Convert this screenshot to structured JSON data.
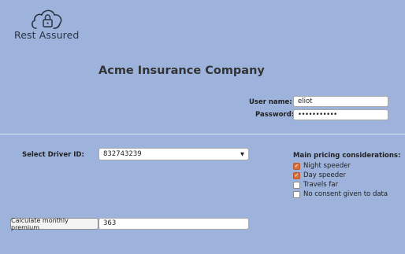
{
  "logo": {
    "text": "Rest Assured",
    "icon": "cloud-lock-icon"
  },
  "company": {
    "title": "Acme Insurance Company"
  },
  "login": {
    "username_label": "User name:",
    "username_value": "eliot",
    "password_label": "Password:",
    "password_value": "•••••••••••"
  },
  "driver": {
    "label": "Select Driver ID:",
    "selected": "832743239"
  },
  "pricing": {
    "title": "Main pricing considerations:",
    "options": [
      {
        "label": "Night speeder",
        "checked": true
      },
      {
        "label": "Day speeder",
        "checked": true
      },
      {
        "label": "Travels far",
        "checked": false
      },
      {
        "label": "No consent given to data",
        "checked": false
      }
    ]
  },
  "premium": {
    "button_label": "Calculate monthly premium",
    "value": "363"
  },
  "colors": {
    "background": "#9db3dc",
    "checkbox_checked": "#d9703f"
  }
}
